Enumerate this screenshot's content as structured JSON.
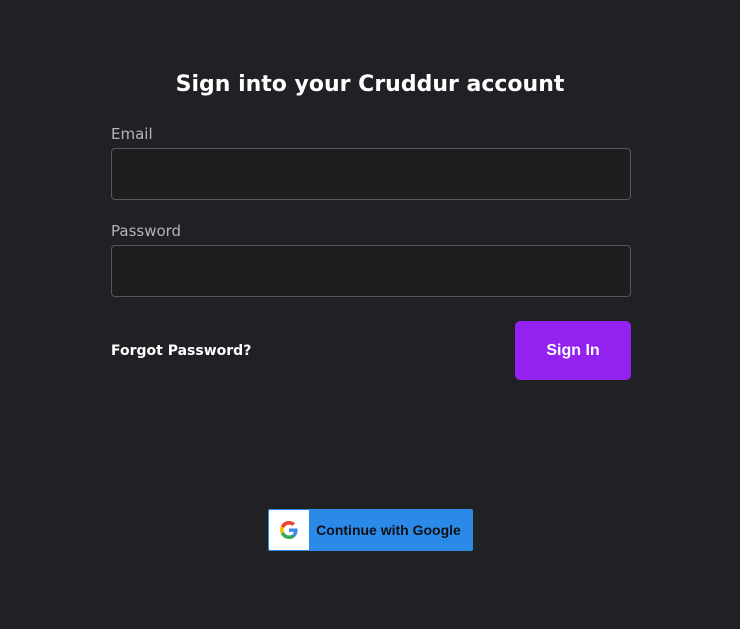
{
  "title": "Sign into your Cruddur account",
  "form": {
    "email_label": "Email",
    "email_value": "",
    "password_label": "Password",
    "password_value": "",
    "forgot_label": "Forgot Password?",
    "signin_label": "Sign In"
  },
  "google": {
    "label": "Continue with Google",
    "icon": "google-g-icon"
  },
  "colors": {
    "background": "#202125",
    "field_background": "#1e1e1e",
    "accent": "#9321ef",
    "google_blue": "#2b8ae7"
  }
}
